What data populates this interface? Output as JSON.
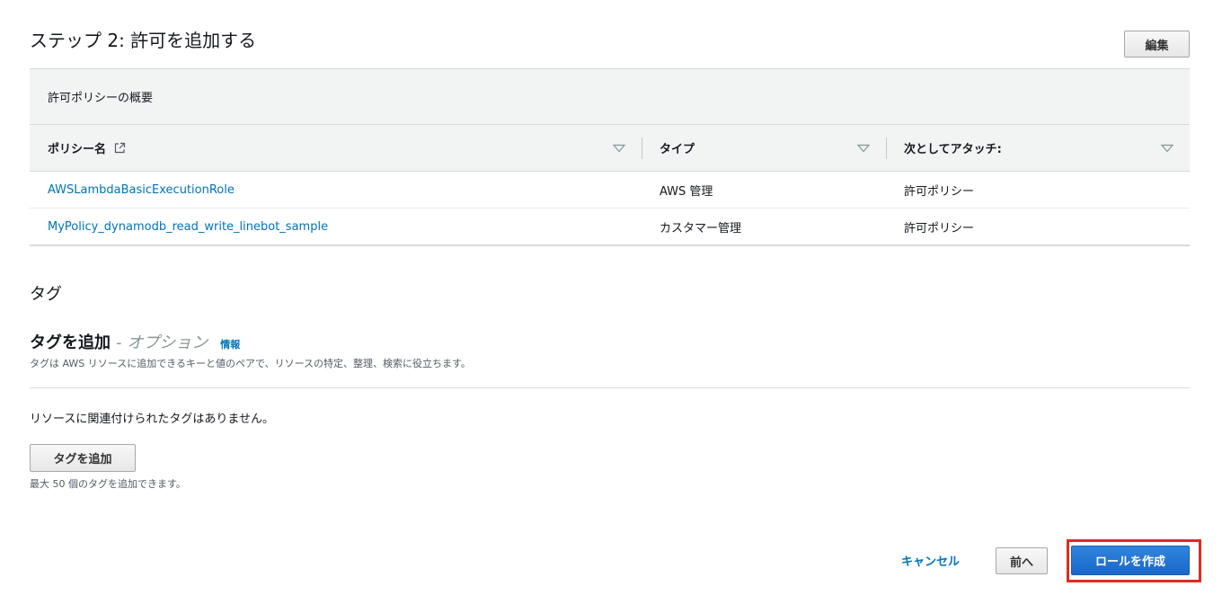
{
  "step": {
    "title": "ステップ 2: 許可を追加する",
    "edit_label": "編集"
  },
  "permissions": {
    "summary_title": "許可ポリシーの概要",
    "columns": [
      "ポリシー名",
      "タイプ",
      "次としてアタッチ:"
    ],
    "rows": [
      {
        "name": "AWSLambdaBasicExecutionRole",
        "type": "AWS 管理",
        "attached_as": "許可ポリシー"
      },
      {
        "name": "MyPolicy_dynamodb_read_write_linebot_sample",
        "type": "カスタマー管理",
        "attached_as": "許可ポリシー"
      }
    ]
  },
  "tags": {
    "heading": "タグ",
    "add_title": "タグを追加",
    "option_label": "- オプション",
    "info_label": "情報",
    "description": "タグは AWS リソースに追加できるキーと値のペアで、リソースの特定、整理、検索に役立ちます。",
    "empty_message": "リソースに関連付けられたタグはありません。",
    "add_button_label": "タグを追加",
    "max_hint": "最大 50 個のタグを追加できます。"
  },
  "footer": {
    "cancel_label": "キャンセル",
    "previous_label": "前へ",
    "create_label": "ロールを作成"
  },
  "colors": {
    "link": "#0073bb",
    "primary_button": "#1b66c9",
    "highlight": "#e02b20",
    "header_bg": "#f2f3f3"
  }
}
